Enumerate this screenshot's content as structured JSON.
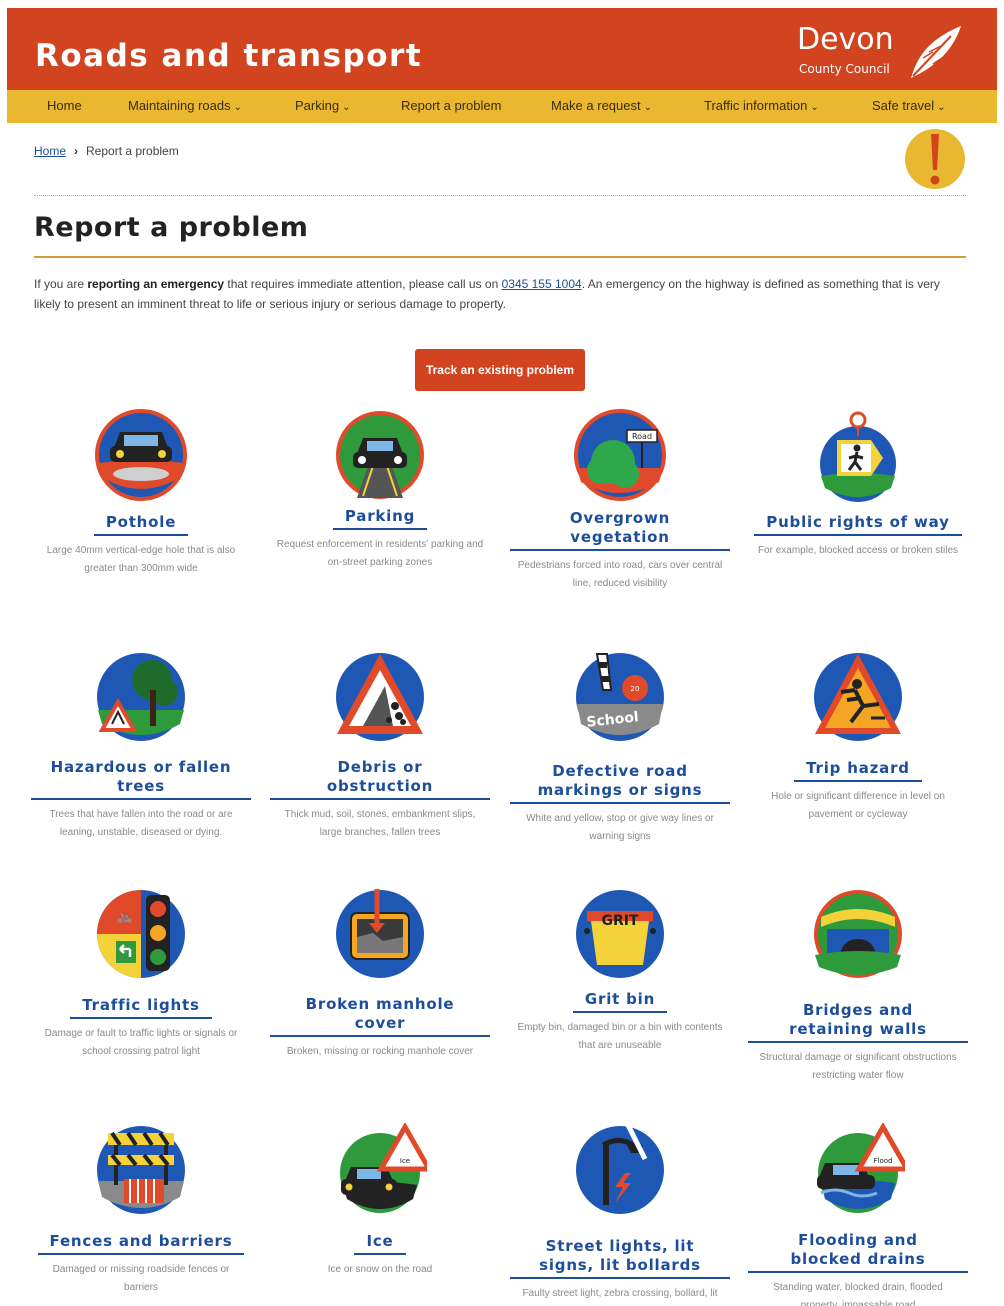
{
  "header": {
    "title": "Roads and transport",
    "logo_line1": "Devon",
    "logo_line2": "County Council",
    "bg": "#d2431f"
  },
  "nav": {
    "bg": "#eab830",
    "items": [
      {
        "label": "Home",
        "dropdown": false
      },
      {
        "label": "Maintaining roads",
        "dropdown": true
      },
      {
        "label": "Parking",
        "dropdown": true
      },
      {
        "label": "Report a problem",
        "dropdown": false
      },
      {
        "label": "Make a request",
        "dropdown": true
      },
      {
        "label": "Traffic information",
        "dropdown": true
      },
      {
        "label": "Safe travel",
        "dropdown": true
      }
    ]
  },
  "breadcrumb": {
    "home": "Home",
    "current": "Report a problem"
  },
  "page": {
    "title": "Report a problem",
    "intro_prefix": "If you are ",
    "intro_bold": "reporting an emergency",
    "intro_mid": " that requires immediate attention, please call us on ",
    "intro_phone": "0345 155 1004",
    "intro_suffix": ". An emergency on the highway is defined as something that is very likely to present an imminent threat to life or serious injury or serious damage to property.",
    "track_button": "Track an existing problem"
  },
  "categories": [
    {
      "label": "Pothole",
      "desc": "Large 40mm vertical-edge hole that is also greater than 300mm wide",
      "icon": "pothole-icon"
    },
    {
      "label": "Parking",
      "desc": "Request enforcement in residents' parking and on-street parking zones",
      "icon": "parking-icon"
    },
    {
      "label": "Overgrown vegetation",
      "desc": "Pedestrians forced into road, cars over central line, reduced visibility",
      "icon": "vegetation-icon"
    },
    {
      "label": "Public rights of way",
      "desc": "For example, blocked access or broken stiles",
      "icon": "rights-of-way-icon"
    },
    {
      "label": "Hazardous or fallen trees",
      "desc": "Trees that have fallen into the road or are leaning, unstable, diseased or dying.",
      "icon": "fallen-tree-icon"
    },
    {
      "label": "Debris or obstruction",
      "desc": "Thick mud, soil, stones, embankment slips, large branches, fallen trees",
      "icon": "debris-icon"
    },
    {
      "label": "Defective road markings or signs",
      "desc": "White and yellow, stop or give way lines or warning signs",
      "icon": "road-markings-icon"
    },
    {
      "label": "Trip hazard",
      "desc": "Hole or significant difference in level on pavement or cycleway",
      "icon": "trip-hazard-icon"
    },
    {
      "label": "Traffic lights",
      "desc": "Damage or fault to traffic lights or signals or school crossing patrol light",
      "icon": "traffic-lights-icon"
    },
    {
      "label": "Broken manhole cover",
      "desc": "Broken, missing or rocking manhole cover",
      "icon": "manhole-icon"
    },
    {
      "label": "Grit bin",
      "desc": "Empty bin, damaged bin or a bin with contents that are unuseable",
      "icon": "grit-bin-icon"
    },
    {
      "label": "Bridges and retaining walls",
      "desc": "Structural damage or significant obstructions restricting water flow",
      "icon": "bridge-icon"
    },
    {
      "label": "Fences and barriers",
      "desc": "Damaged or missing roadside fences or barriers",
      "icon": "fence-icon"
    },
    {
      "label": "Ice",
      "desc": "Ice or snow on the road",
      "icon": "ice-icon"
    },
    {
      "label": "Street lights, lit signs, lit bollards",
      "desc": "Faulty street light, zebra crossing, bollard, lit sign",
      "icon": "street-light-icon"
    },
    {
      "label": "Flooding and blocked drains",
      "desc": "Standing water, blocked drain, flooded property, impassable road",
      "icon": "flooding-icon"
    }
  ],
  "colors": {
    "accent": "#d2431f",
    "nav": "#eab830",
    "link": "#1d4e9a",
    "icon_blue": "#1e58b4",
    "icon_ring": "#e0492a"
  }
}
